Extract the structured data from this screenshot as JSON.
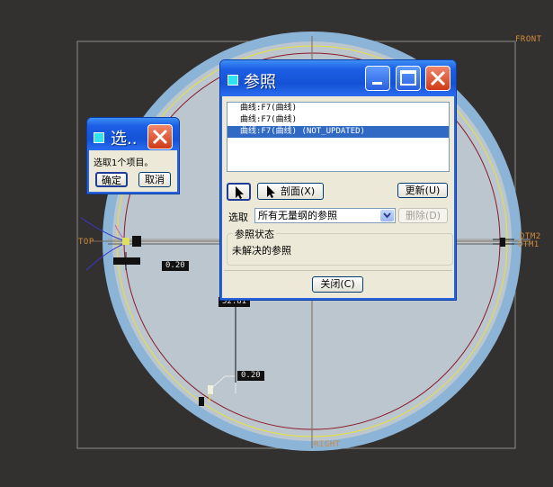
{
  "viewport": {
    "datum_labels": {
      "front": "FRONT",
      "top": "TOP",
      "dtm2": "DTM2",
      "dtm1": "DTM1",
      "right": "RIGHT"
    },
    "dimensions": {
      "dim_left": "0.20",
      "dim_top_center": "52.81",
      "dim_lower": "0.20"
    },
    "colors": {
      "background": "#333130",
      "disk_fill": "#bcc6ce",
      "rim": "#8cb4d6",
      "yellow_curve": "#e6e23a",
      "red_curve": "#8b1a2a"
    }
  },
  "select_dialog": {
    "title": "选..",
    "message": "选取1个项目。",
    "ok_label": "确定",
    "cancel_label": "取消"
  },
  "ref_dialog": {
    "title": "参照",
    "list_items": [
      "曲线:F7(曲线)",
      "曲线:F7(曲线)",
      "曲线:F7(曲线)  (NOT_UPDATED)"
    ],
    "selected_index": 2,
    "pointer_icon": "arrow-pointer-icon",
    "section_label": "剖面(X)",
    "update_label": "更新(U)",
    "select_label": "选取",
    "filter_value": "所有无量纲的参照",
    "delete_label": "删除(D)",
    "status_caption": "参照状态",
    "status_text": "未解决的参照",
    "close_label": "关闭(C)"
  }
}
